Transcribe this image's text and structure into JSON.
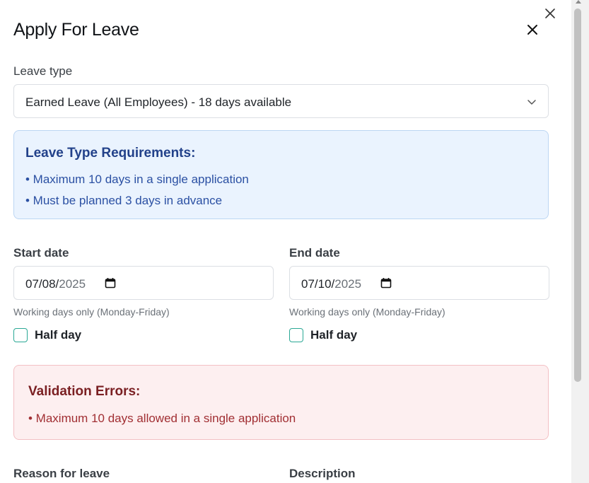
{
  "dialog": {
    "title": "Apply For Leave",
    "outer_close_icon": "close-icon",
    "inner_close_icon": "close-icon"
  },
  "leave_type": {
    "label": "Leave type",
    "selected": "Earned Leave (All Employees) - 18 days available",
    "icon": "chevron-down-icon"
  },
  "requirements": {
    "heading": "Leave Type Requirements:",
    "items": [
      "• Maximum 10 days in a single application",
      "• Must be planned 3 days in advance"
    ],
    "colors": {
      "background": "#eaf3fe",
      "border": "#bcd6f3",
      "text": "#2b50a3"
    }
  },
  "start_date": {
    "label": "Start date",
    "month_day": "07/08/",
    "year": "2025",
    "hint": "Working days only (Monday-Friday)",
    "half_day_label": "Half day",
    "half_day_checked": false
  },
  "end_date": {
    "label": "End date",
    "month_day": "07/10/",
    "year": "2025",
    "hint": "Working days only (Monday-Friday)",
    "half_day_label": "Half day",
    "half_day_checked": false
  },
  "validation": {
    "heading": "Validation Errors:",
    "items": [
      "• Maximum 10 days allowed in a single application"
    ],
    "colors": {
      "background": "#fdeff0",
      "border": "#f3c0c4",
      "text": "#a12f33"
    }
  },
  "reason": {
    "label": "Reason for leave"
  },
  "description": {
    "label": "Description"
  },
  "accent_color": "#2aa895"
}
